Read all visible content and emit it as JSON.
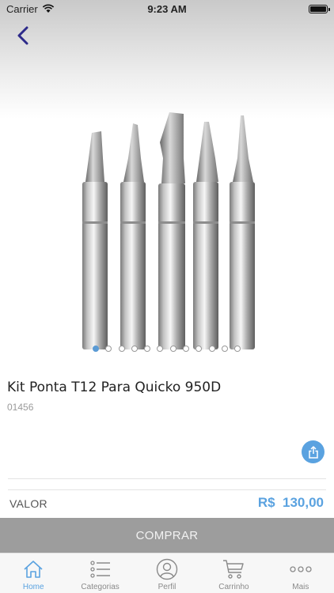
{
  "status_bar": {
    "carrier": "Carrier",
    "time": "9:23 AM"
  },
  "product": {
    "title": "Kit Ponta T12 Para Quicko 950D",
    "code": "01456",
    "image_icon": "soldering-tips-image",
    "carousel_pages": 12,
    "carousel_active_index": 0
  },
  "price": {
    "label": "VALOR",
    "value": "R$  130,00"
  },
  "buy_button": {
    "label": "COMPRAR"
  },
  "tab_bar": {
    "tabs": [
      {
        "label": "Home",
        "icon": "home-icon",
        "active": true
      },
      {
        "label": "Categorias",
        "icon": "list-icon",
        "active": false
      },
      {
        "label": "Perfil",
        "icon": "user-icon",
        "active": false
      },
      {
        "label": "Carrinho",
        "icon": "cart-icon",
        "active": false
      },
      {
        "label": "Mais",
        "icon": "more-icon",
        "active": false
      }
    ]
  },
  "colors": {
    "accent": "#5aa2e0",
    "buy_button_bg": "#9d9d9d",
    "back_arrow": "#2d2a8a"
  }
}
